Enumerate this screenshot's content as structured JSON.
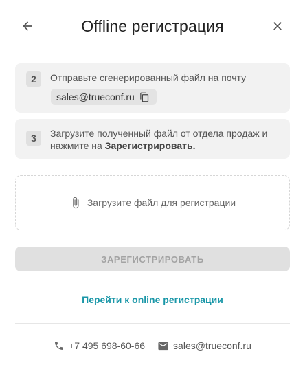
{
  "header": {
    "title": "Offline регистрация",
    "back_icon": "arrow-left-icon",
    "close_icon": "close-icon"
  },
  "steps": [
    {
      "number": "2",
      "text": "Отправьте сгенерированный файл на почту",
      "email": "sales@trueconf.ru",
      "copy_icon": "copy-icon"
    },
    {
      "number": "3",
      "text_before": "Загрузите полученный файл от отдела продаж и нажмите на ",
      "text_bold": "Зарегистрировать."
    }
  ],
  "upload": {
    "label": "Загрузите файл для регистрации",
    "icon": "paperclip-icon"
  },
  "register_button": {
    "label": "ЗАРЕГИСТРИРОВАТЬ",
    "state": "disabled"
  },
  "online_link": "Перейти к online регистрации",
  "footer": {
    "phone": "+7 495 698-60-66",
    "email": "sales@trueconf.ru"
  },
  "colors": {
    "accent": "#1a97a8",
    "card_background": "#f2f2f2",
    "disabled_button": "#e0e0e0",
    "disabled_text": "#a3a3a3"
  }
}
